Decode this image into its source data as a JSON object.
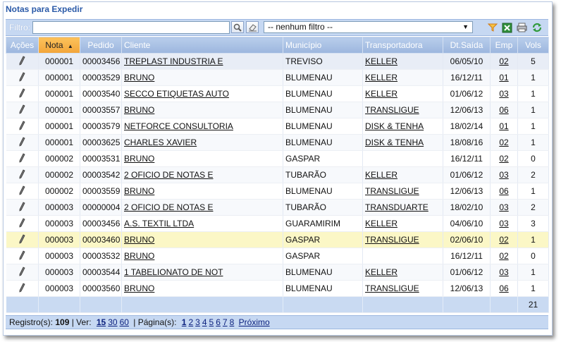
{
  "title": "Notas para Expedir",
  "filter": {
    "label": "Filtro:",
    "value": "",
    "select_value": "-- nenhum filtro --"
  },
  "columns": [
    "Ações",
    "Nota",
    "Pedido",
    "Cliente",
    "Município",
    "Transportadora",
    "Dt.Saída",
    "Emp",
    "Vols"
  ],
  "sorted_column": "Nota",
  "rows": [
    {
      "nota": "000001",
      "pedido": "00003456",
      "cliente": "TREPLAST INDUSTRIA E",
      "municipio": "TREVISO",
      "transportadora": "KELLER",
      "dt_saida": "06/05/10",
      "emp": "02",
      "vols": "5"
    },
    {
      "nota": "000001",
      "pedido": "00003529",
      "cliente": "BRUNO",
      "municipio": "BLUMENAU",
      "transportadora": "KELLER",
      "dt_saida": "16/12/11",
      "emp": "01",
      "vols": "1"
    },
    {
      "nota": "000001",
      "pedido": "00003540",
      "cliente": "SECCO ETIQUETAS AUTO",
      "municipio": "BLUMENAU",
      "transportadora": "KELLER",
      "dt_saida": "01/06/12",
      "emp": "03",
      "vols": "1"
    },
    {
      "nota": "000001",
      "pedido": "00003557",
      "cliente": "BRUNO",
      "municipio": "BLUMENAU",
      "transportadora": "TRANSLIGUE",
      "dt_saida": "12/06/13",
      "emp": "06",
      "vols": "1"
    },
    {
      "nota": "000001",
      "pedido": "00003579",
      "cliente": "NETFORCE CONSULTORIA",
      "municipio": "BLUMENAU",
      "transportadora": "DISK & TENHA",
      "dt_saida": "18/02/14",
      "emp": "01",
      "vols": "1"
    },
    {
      "nota": "000001",
      "pedido": "00003625",
      "cliente": "CHARLES XAVIER",
      "municipio": "BLUMENAU",
      "transportadora": "DISK & TENHA",
      "dt_saida": "18/08/16",
      "emp": "02",
      "vols": "1"
    },
    {
      "nota": "000002",
      "pedido": "00003531",
      "cliente": "BRUNO",
      "municipio": "GASPAR",
      "transportadora": "",
      "dt_saida": "16/12/11",
      "emp": "02",
      "vols": "0"
    },
    {
      "nota": "000002",
      "pedido": "00003542",
      "cliente": "2 OFICIO DE NOTAS E",
      "municipio": "TUBARÃO",
      "transportadora": "KELLER",
      "dt_saida": "01/06/12",
      "emp": "03",
      "vols": "2"
    },
    {
      "nota": "000002",
      "pedido": "00003559",
      "cliente": "BRUNO",
      "municipio": "BLUMENAU",
      "transportadora": "TRANSLIGUE",
      "dt_saida": "12/06/13",
      "emp": "06",
      "vols": "1"
    },
    {
      "nota": "000003",
      "pedido": "00000004",
      "cliente": "2 OFICIO DE NOTAS E",
      "municipio": "TUBARÃO",
      "transportadora": "TRANSDUARTE",
      "dt_saida": "18/02/10",
      "emp": "03",
      "vols": "2"
    },
    {
      "nota": "000003",
      "pedido": "00003456",
      "cliente": "A.S. TEXTIL LTDA",
      "municipio": "GUARAMIRIM",
      "transportadora": "KELLER",
      "dt_saida": "04/06/10",
      "emp": "03",
      "vols": "3"
    },
    {
      "nota": "000003",
      "pedido": "00003460",
      "cliente": "BRUNO",
      "municipio": "GASPAR",
      "transportadora": "TRANSLIGUE",
      "dt_saida": "02/06/10",
      "emp": "02",
      "vols": "1"
    },
    {
      "nota": "000003",
      "pedido": "00003532",
      "cliente": "BRUNO",
      "municipio": "GASPAR",
      "transportadora": "",
      "dt_saida": "16/12/11",
      "emp": "02",
      "vols": "0"
    },
    {
      "nota": "000003",
      "pedido": "00003544",
      "cliente": "1 TABELIONATO DE NOT",
      "municipio": "BLUMENAU",
      "transportadora": "KELLER",
      "dt_saida": "01/06/12",
      "emp": "03",
      "vols": "1"
    },
    {
      "nota": "000003",
      "pedido": "00003560",
      "cliente": "BRUNO",
      "municipio": "BLUMENAU",
      "transportadora": "TRANSLIGUE",
      "dt_saida": "12/06/13",
      "emp": "06",
      "vols": "1"
    }
  ],
  "highlighted_row_index": 11,
  "total_vols": "21",
  "footer": {
    "registros_label": "Registro(s):",
    "registros_count": "109",
    "ver_label": "| Ver:",
    "ver_options": [
      "15",
      "30",
      "60"
    ],
    "pagina_label": "| Página(s):",
    "pages": [
      "1",
      "2",
      "3",
      "4",
      "5",
      "6",
      "7",
      "8"
    ],
    "next_label": "Próximo"
  }
}
